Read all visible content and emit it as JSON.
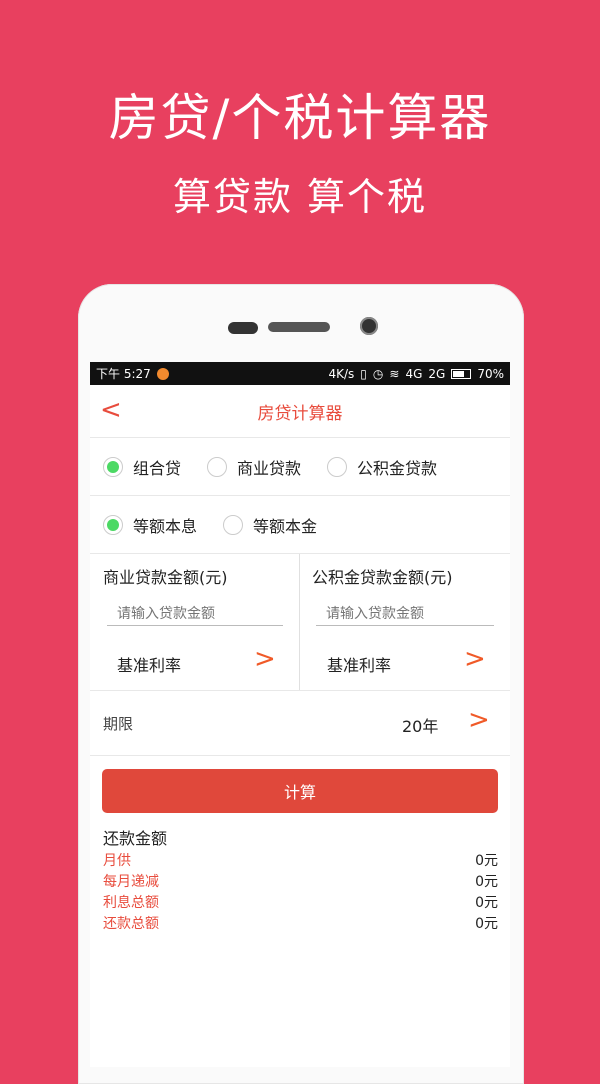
{
  "promo": {
    "title": "房贷/个税计算器",
    "subtitle": "算贷款 算个税"
  },
  "status_bar": {
    "time": "下午 5:27",
    "speed": "4K/s",
    "net1": "4G",
    "net2": "2G",
    "battery": "70%"
  },
  "navbar": {
    "back": "<",
    "title": "房贷计算器"
  },
  "loan_type": {
    "options": [
      "组合贷",
      "商业贷款",
      "公积金贷款"
    ],
    "selected": "组合贷"
  },
  "repay_method": {
    "options": [
      "等额本息",
      "等额本金"
    ],
    "selected": "等额本息"
  },
  "commercial": {
    "label": "商业贷款金额(元)",
    "placeholder": "请输入贷款金额",
    "rate_label": "基准利率"
  },
  "fund": {
    "label": "公积金贷款金额(元)",
    "placeholder": "请输入贷款金额",
    "rate_label": "基准利率"
  },
  "term": {
    "label": "期限",
    "value": "20年"
  },
  "calculate_label": "计算",
  "result": {
    "title": "还款金额",
    "items": [
      {
        "key": "月供",
        "value": "0元"
      },
      {
        "key": "每月递减",
        "value": "0元"
      },
      {
        "key": "利息总额",
        "value": "0元"
      },
      {
        "key": "还款总额",
        "value": "0元"
      }
    ]
  },
  "colors": {
    "background": "#e8405f",
    "accent": "#e84c3d",
    "radio_on": "#4cd964",
    "arrow": "#f05a28"
  }
}
